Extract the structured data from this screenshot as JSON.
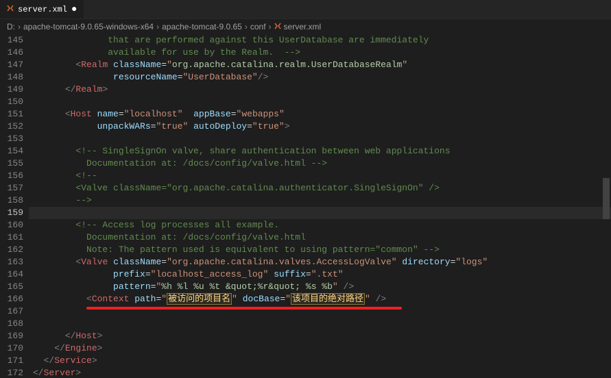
{
  "tab": {
    "filename": "server.xml",
    "modified_indicator": "●"
  },
  "breadcrumbs": {
    "segments": [
      "D:",
      "apache-tomcat-9.0.65-windows-x64",
      "apache-tomcat-9.0.65",
      "conf",
      "server.xml"
    ]
  },
  "line_numbers": {
    "start": 145,
    "end": 172,
    "active": 159
  },
  "code": {
    "l145": "              that are performed against this UserDatabase are immediately",
    "l146": "              available for use by the Realm.  -->",
    "l147": {
      "tag": "Realm",
      "attr": "className",
      "val": "org.apache.catalina.realm.UserDatabaseRealm"
    },
    "l148": {
      "attr": "resourceName",
      "val": "UserDatabase"
    },
    "l149": {
      "closetag": "Realm"
    },
    "l151": {
      "tag": "Host",
      "a1": "name",
      "v1": "localhost",
      "a2": "appBase",
      "v2": "webapps"
    },
    "l152": {
      "a1": "unpackWARs",
      "v1": "true",
      "a2": "autoDeploy",
      "v2": "true"
    },
    "l154": "<!-- SingleSignOn valve, share authentication between web applications",
    "l155": "      Documentation at: /docs/config/valve.html -->",
    "l156": "<!--",
    "l157": "<Valve className=\"org.apache.catalina.authenticator.SingleSignOn\" />",
    "l158": "-->",
    "l160": "<!-- Access log processes all example.",
    "l161": "      Documentation at: /docs/config/valve.html",
    "l162": "      Note: The pattern used is equivalent to using pattern=\"common\" -->",
    "l163": {
      "tag": "Valve",
      "a1": "className",
      "v1": "org.apache.catalina.valves.AccessLogValve",
      "a2": "directory",
      "v2": "logs"
    },
    "l164": {
      "a1": "prefix",
      "v1": "localhost_access_log",
      "a2": "suffix",
      "v2": ".txt"
    },
    "l165": {
      "a1": "pattern",
      "v1": "%h %l %u %t &quot;%r&quot; %s %b"
    },
    "l166": {
      "tag": "Context",
      "a1": "path",
      "v1": "被访问的项目名",
      "a2": "docBase",
      "v2": "该项目的绝对路径"
    },
    "l169": {
      "closetag": "Host"
    },
    "l170": {
      "closetag": "Engine"
    },
    "l171": {
      "closetag": "Service"
    },
    "l172": {
      "closetag": "Server"
    }
  }
}
